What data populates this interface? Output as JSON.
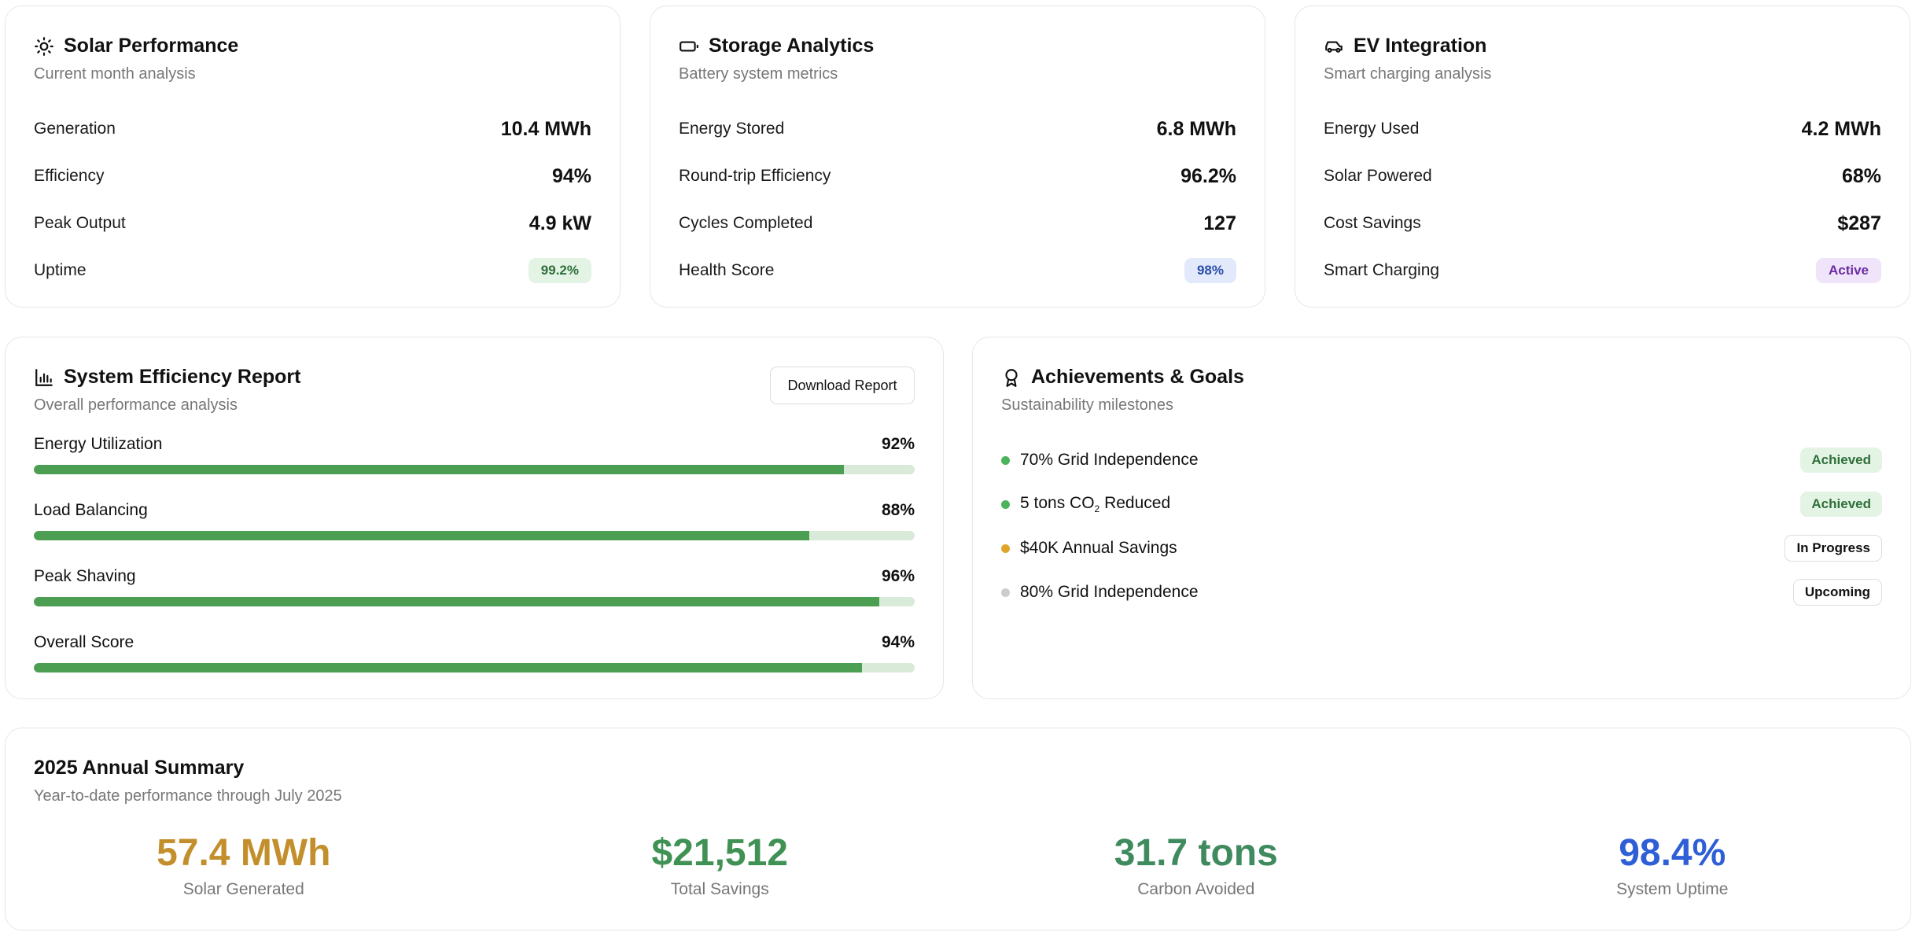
{
  "cards": {
    "solar": {
      "title": "Solar Performance",
      "subtitle": "Current month analysis",
      "metrics": [
        {
          "label": "Generation",
          "value": "10.4 MWh"
        },
        {
          "label": "Efficiency",
          "value": "94%"
        },
        {
          "label": "Peak Output",
          "value": "4.9 kW"
        },
        {
          "label": "Uptime",
          "value": "99.2%"
        }
      ]
    },
    "storage": {
      "title": "Storage Analytics",
      "subtitle": "Battery system metrics",
      "metrics": [
        {
          "label": "Energy Stored",
          "value": "6.8 MWh"
        },
        {
          "label": "Round-trip Efficiency",
          "value": "96.2%"
        },
        {
          "label": "Cycles Completed",
          "value": "127"
        },
        {
          "label": "Health Score",
          "value": "98%"
        }
      ]
    },
    "ev": {
      "title": "EV Integration",
      "subtitle": "Smart charging analysis",
      "metrics": [
        {
          "label": "Energy Used",
          "value": "4.2 MWh"
        },
        {
          "label": "Solar Powered",
          "value": "68%"
        },
        {
          "label": "Cost Savings",
          "value": "$287"
        },
        {
          "label": "Smart Charging",
          "value": "Active"
        }
      ]
    }
  },
  "efficiency": {
    "title": "System Efficiency Report",
    "subtitle": "Overall performance analysis",
    "download_label": "Download Report",
    "bars": [
      {
        "label": "Energy Utilization",
        "value_text": "92%",
        "value": 92
      },
      {
        "label": "Load Balancing",
        "value_text": "88%",
        "value": 88
      },
      {
        "label": "Peak Shaving",
        "value_text": "96%",
        "value": 96
      },
      {
        "label": "Overall Score",
        "value_text": "94%",
        "value": 94
      }
    ]
  },
  "achievements": {
    "title": "Achievements & Goals",
    "subtitle": "Sustainability milestones",
    "goals": [
      {
        "label": "70% Grid Independence",
        "status": "Achieved",
        "dot_color": "#4bb35a"
      },
      {
        "label_pre": "5 tons CO",
        "label_sub": "2",
        "label_post": " Reduced",
        "status": "Achieved",
        "dot_color": "#4bb35a"
      },
      {
        "label": "$40K Annual Savings",
        "status": "In Progress",
        "dot_color": "#e0a528"
      },
      {
        "label": "80% Grid Independence",
        "status": "Upcoming",
        "dot_color": "#cccccc"
      }
    ]
  },
  "annual": {
    "title": "2025 Annual Summary",
    "subtitle": "Year-to-date performance through July 2025",
    "stats": [
      {
        "value": "57.4 MWh",
        "label": "Solar Generated",
        "color": "#c28f2c"
      },
      {
        "value": "$21,512",
        "label": "Total Savings",
        "color": "#3f9154"
      },
      {
        "value": "31.7 tons",
        "label": "Carbon Avoided",
        "color": "#3f8a5e"
      },
      {
        "value": "98.4%",
        "label": "System Uptime",
        "color": "#2f5fd6"
      }
    ]
  },
  "colors": {
    "bar_fill": "#4b9e52",
    "bar_track": "#d9ead9",
    "uptime_pill_bg": "#e3f4e5",
    "uptime_pill_fg": "#2f6f3a",
    "health_pill_bg": "#e2e9fb",
    "health_pill_fg": "#2a4da8",
    "active_pill_bg": "#efe4fa",
    "active_pill_fg": "#6b2ea3"
  },
  "icons": {
    "solar": "sun-icon",
    "storage": "battery-icon",
    "ev": "car-icon",
    "efficiency": "bar-chart-icon",
    "achievements": "award-icon"
  }
}
